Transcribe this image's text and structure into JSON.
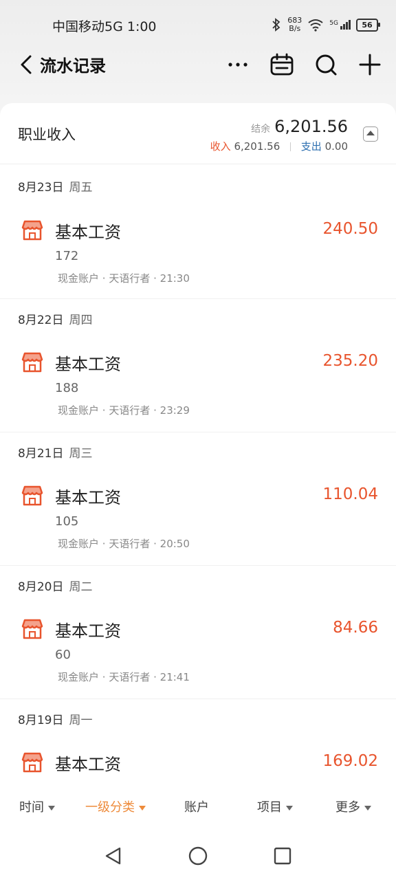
{
  "status": {
    "time": "中国移动5G 1:00",
    "net_speed_value": "683",
    "net_speed_unit": "B/s",
    "signal": "5G",
    "battery": "56"
  },
  "nav": {
    "title": "流水记录"
  },
  "summary": {
    "category": "职业收入",
    "balance_label": "结余",
    "balance": "6,201.56",
    "income_label": "收入",
    "income": "6,201.56",
    "expense_label": "支出",
    "expense": "0.00"
  },
  "days": [
    {
      "date": "8月23日",
      "weekday": "周五",
      "entry": {
        "name": "基本工资",
        "note": "172",
        "account": "现金账户",
        "payer": "天语行者",
        "time": "21:30",
        "amount": "240.50"
      }
    },
    {
      "date": "8月22日",
      "weekday": "周四",
      "entry": {
        "name": "基本工资",
        "note": "188",
        "account": "现金账户",
        "payer": "天语行者",
        "time": "23:29",
        "amount": "235.20"
      }
    },
    {
      "date": "8月21日",
      "weekday": "周三",
      "entry": {
        "name": "基本工资",
        "note": "105",
        "account": "现金账户",
        "payer": "天语行者",
        "time": "20:50",
        "amount": "110.04"
      }
    },
    {
      "date": "8月20日",
      "weekday": "周二",
      "entry": {
        "name": "基本工资",
        "note": "60",
        "account": "现金账户",
        "payer": "天语行者",
        "time": "21:41",
        "amount": "84.66"
      }
    },
    {
      "date": "8月19日",
      "weekday": "周一",
      "entry": {
        "name": "基本工资",
        "amount": "169.02"
      }
    }
  ],
  "filters": [
    {
      "label": "时间",
      "has_dropdown": true
    },
    {
      "label": "一级分类",
      "has_dropdown": true,
      "active": true
    },
    {
      "label": "账户",
      "has_dropdown": false
    },
    {
      "label": "项目",
      "has_dropdown": true
    },
    {
      "label": "更多",
      "has_dropdown": true
    }
  ],
  "colors": {
    "income": "#e8542d",
    "expense": "#2d6fb0",
    "active_filter": "#ee8b3b"
  },
  "icons": [
    "back-icon",
    "more-icon",
    "calendar-icon",
    "search-icon",
    "add-icon",
    "shop-icon"
  ]
}
